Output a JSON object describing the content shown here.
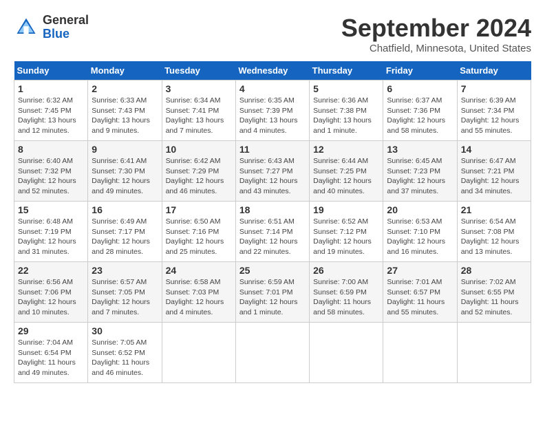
{
  "header": {
    "logo_general": "General",
    "logo_blue": "Blue",
    "month_title": "September 2024",
    "location": "Chatfield, Minnesota, United States"
  },
  "columns": [
    "Sunday",
    "Monday",
    "Tuesday",
    "Wednesday",
    "Thursday",
    "Friday",
    "Saturday"
  ],
  "weeks": [
    [
      {
        "day": "1",
        "sunrise": "Sunrise: 6:32 AM",
        "sunset": "Sunset: 7:45 PM",
        "daylight": "Daylight: 13 hours and 12 minutes."
      },
      {
        "day": "2",
        "sunrise": "Sunrise: 6:33 AM",
        "sunset": "Sunset: 7:43 PM",
        "daylight": "Daylight: 13 hours and 9 minutes."
      },
      {
        "day": "3",
        "sunrise": "Sunrise: 6:34 AM",
        "sunset": "Sunset: 7:41 PM",
        "daylight": "Daylight: 13 hours and 7 minutes."
      },
      {
        "day": "4",
        "sunrise": "Sunrise: 6:35 AM",
        "sunset": "Sunset: 7:39 PM",
        "daylight": "Daylight: 13 hours and 4 minutes."
      },
      {
        "day": "5",
        "sunrise": "Sunrise: 6:36 AM",
        "sunset": "Sunset: 7:38 PM",
        "daylight": "Daylight: 13 hours and 1 minute."
      },
      {
        "day": "6",
        "sunrise": "Sunrise: 6:37 AM",
        "sunset": "Sunset: 7:36 PM",
        "daylight": "Daylight: 12 hours and 58 minutes."
      },
      {
        "day": "7",
        "sunrise": "Sunrise: 6:39 AM",
        "sunset": "Sunset: 7:34 PM",
        "daylight": "Daylight: 12 hours and 55 minutes."
      }
    ],
    [
      {
        "day": "8",
        "sunrise": "Sunrise: 6:40 AM",
        "sunset": "Sunset: 7:32 PM",
        "daylight": "Daylight: 12 hours and 52 minutes."
      },
      {
        "day": "9",
        "sunrise": "Sunrise: 6:41 AM",
        "sunset": "Sunset: 7:30 PM",
        "daylight": "Daylight: 12 hours and 49 minutes."
      },
      {
        "day": "10",
        "sunrise": "Sunrise: 6:42 AM",
        "sunset": "Sunset: 7:29 PM",
        "daylight": "Daylight: 12 hours and 46 minutes."
      },
      {
        "day": "11",
        "sunrise": "Sunrise: 6:43 AM",
        "sunset": "Sunset: 7:27 PM",
        "daylight": "Daylight: 12 hours and 43 minutes."
      },
      {
        "day": "12",
        "sunrise": "Sunrise: 6:44 AM",
        "sunset": "Sunset: 7:25 PM",
        "daylight": "Daylight: 12 hours and 40 minutes."
      },
      {
        "day": "13",
        "sunrise": "Sunrise: 6:45 AM",
        "sunset": "Sunset: 7:23 PM",
        "daylight": "Daylight: 12 hours and 37 minutes."
      },
      {
        "day": "14",
        "sunrise": "Sunrise: 6:47 AM",
        "sunset": "Sunset: 7:21 PM",
        "daylight": "Daylight: 12 hours and 34 minutes."
      }
    ],
    [
      {
        "day": "15",
        "sunrise": "Sunrise: 6:48 AM",
        "sunset": "Sunset: 7:19 PM",
        "daylight": "Daylight: 12 hours and 31 minutes."
      },
      {
        "day": "16",
        "sunrise": "Sunrise: 6:49 AM",
        "sunset": "Sunset: 7:17 PM",
        "daylight": "Daylight: 12 hours and 28 minutes."
      },
      {
        "day": "17",
        "sunrise": "Sunrise: 6:50 AM",
        "sunset": "Sunset: 7:16 PM",
        "daylight": "Daylight: 12 hours and 25 minutes."
      },
      {
        "day": "18",
        "sunrise": "Sunrise: 6:51 AM",
        "sunset": "Sunset: 7:14 PM",
        "daylight": "Daylight: 12 hours and 22 minutes."
      },
      {
        "day": "19",
        "sunrise": "Sunrise: 6:52 AM",
        "sunset": "Sunset: 7:12 PM",
        "daylight": "Daylight: 12 hours and 19 minutes."
      },
      {
        "day": "20",
        "sunrise": "Sunrise: 6:53 AM",
        "sunset": "Sunset: 7:10 PM",
        "daylight": "Daylight: 12 hours and 16 minutes."
      },
      {
        "day": "21",
        "sunrise": "Sunrise: 6:54 AM",
        "sunset": "Sunset: 7:08 PM",
        "daylight": "Daylight: 12 hours and 13 minutes."
      }
    ],
    [
      {
        "day": "22",
        "sunrise": "Sunrise: 6:56 AM",
        "sunset": "Sunset: 7:06 PM",
        "daylight": "Daylight: 12 hours and 10 minutes."
      },
      {
        "day": "23",
        "sunrise": "Sunrise: 6:57 AM",
        "sunset": "Sunset: 7:05 PM",
        "daylight": "Daylight: 12 hours and 7 minutes."
      },
      {
        "day": "24",
        "sunrise": "Sunrise: 6:58 AM",
        "sunset": "Sunset: 7:03 PM",
        "daylight": "Daylight: 12 hours and 4 minutes."
      },
      {
        "day": "25",
        "sunrise": "Sunrise: 6:59 AM",
        "sunset": "Sunset: 7:01 PM",
        "daylight": "Daylight: 12 hours and 1 minute."
      },
      {
        "day": "26",
        "sunrise": "Sunrise: 7:00 AM",
        "sunset": "Sunset: 6:59 PM",
        "daylight": "Daylight: 11 hours and 58 minutes."
      },
      {
        "day": "27",
        "sunrise": "Sunrise: 7:01 AM",
        "sunset": "Sunset: 6:57 PM",
        "daylight": "Daylight: 11 hours and 55 minutes."
      },
      {
        "day": "28",
        "sunrise": "Sunrise: 7:02 AM",
        "sunset": "Sunset: 6:55 PM",
        "daylight": "Daylight: 11 hours and 52 minutes."
      }
    ],
    [
      {
        "day": "29",
        "sunrise": "Sunrise: 7:04 AM",
        "sunset": "Sunset: 6:54 PM",
        "daylight": "Daylight: 11 hours and 49 minutes."
      },
      {
        "day": "30",
        "sunrise": "Sunrise: 7:05 AM",
        "sunset": "Sunset: 6:52 PM",
        "daylight": "Daylight: 11 hours and 46 minutes."
      },
      null,
      null,
      null,
      null,
      null
    ]
  ]
}
